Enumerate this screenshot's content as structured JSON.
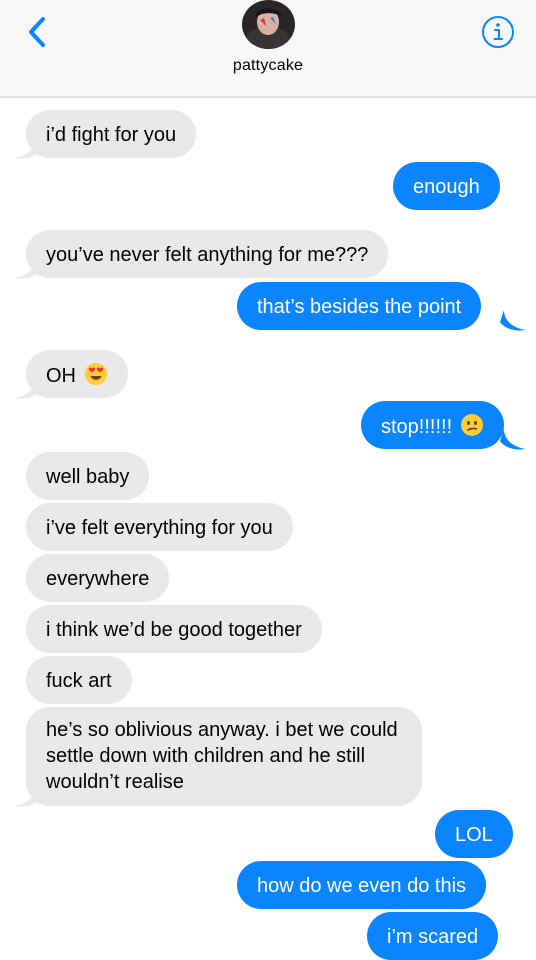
{
  "header": {
    "contact_name": "pattycake",
    "back_icon": "chevron-left-icon",
    "info_icon": "info-circle-icon",
    "accent_color": "#0a84ff"
  },
  "messages": [
    {
      "side": "received",
      "text": "i’d fight for you"
    },
    {
      "side": "sent",
      "text": "enough"
    },
    {
      "side": "received",
      "text": "you’ve never felt anything for me???"
    },
    {
      "side": "sent",
      "text": "that’s besides the point"
    },
    {
      "side": "received",
      "text": "OH",
      "emoji": "heart-eyes-emoji"
    },
    {
      "side": "sent",
      "text": "stop!!!!!!",
      "emoji": "confused-face-emoji"
    },
    {
      "side": "received",
      "text": "well baby"
    },
    {
      "side": "received",
      "text": "i’ve felt everything for you"
    },
    {
      "side": "received",
      "text": "everywhere"
    },
    {
      "side": "received",
      "text": "i think we’d be good together"
    },
    {
      "side": "received",
      "text": "fuck art"
    },
    {
      "side": "received",
      "text": "he’s so oblivious anyway. i bet we could settle down with children and he still wouldn’t realise"
    },
    {
      "side": "sent",
      "text": "LOL"
    },
    {
      "side": "sent",
      "text": "how do we even do this"
    },
    {
      "side": "sent",
      "text": "i’m scared"
    }
  ]
}
